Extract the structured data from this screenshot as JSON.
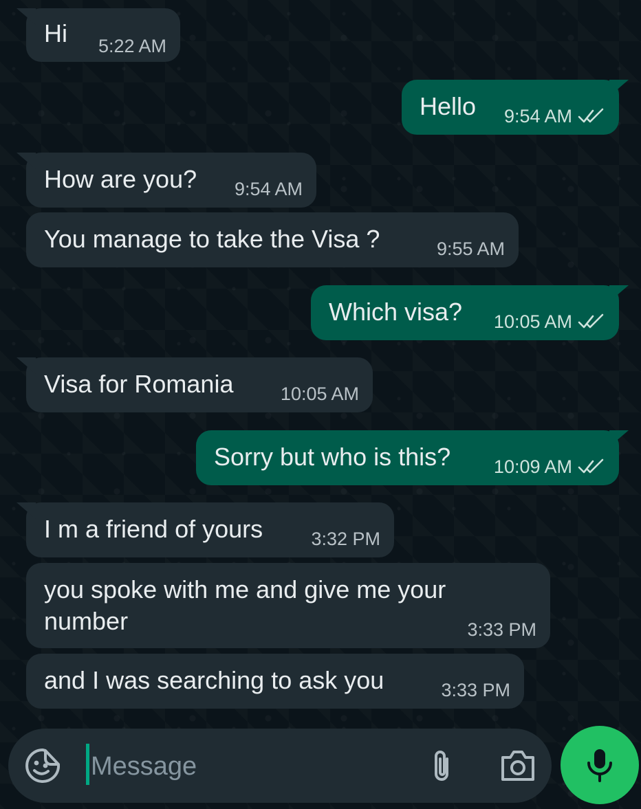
{
  "messages": [
    {
      "direction": "in",
      "text": "Hi",
      "time": "5:22 AM"
    },
    {
      "direction": "out",
      "text": "Hello",
      "time": "9:54 AM",
      "status": "read"
    },
    {
      "direction": "in",
      "text": "How are you?",
      "time": "9:54 AM"
    },
    {
      "direction": "in",
      "text": "You manage to take the Visa ?",
      "time": "9:55 AM"
    },
    {
      "direction": "out",
      "text": "Which visa?",
      "time": "10:05 AM",
      "status": "read"
    },
    {
      "direction": "in",
      "text": "Visa for Romania",
      "time": "10:05 AM"
    },
    {
      "direction": "out",
      "text": "Sorry but who is this?",
      "time": "10:09 AM",
      "status": "read"
    },
    {
      "direction": "in",
      "text": "I m a friend of yours",
      "time": "3:32 PM"
    },
    {
      "direction": "in",
      "text": "you spoke with me and give me your\nnumber",
      "time": "3:33 PM"
    },
    {
      "direction": "in",
      "text": "and I was searching to ask you",
      "time": "3:33 PM"
    }
  ],
  "composer": {
    "placeholder": "Message",
    "emoji_icon": "sticker-smiley-icon",
    "attach_icon": "paperclip-icon",
    "camera_icon": "camera-icon"
  },
  "mic_button": {
    "icon": "microphone-icon"
  },
  "colors": {
    "background": "#0b141a",
    "incoming_bubble": "#202c33",
    "outgoing_bubble": "#005c4b",
    "accent_green": "#21c063",
    "cursor": "#00a884"
  }
}
